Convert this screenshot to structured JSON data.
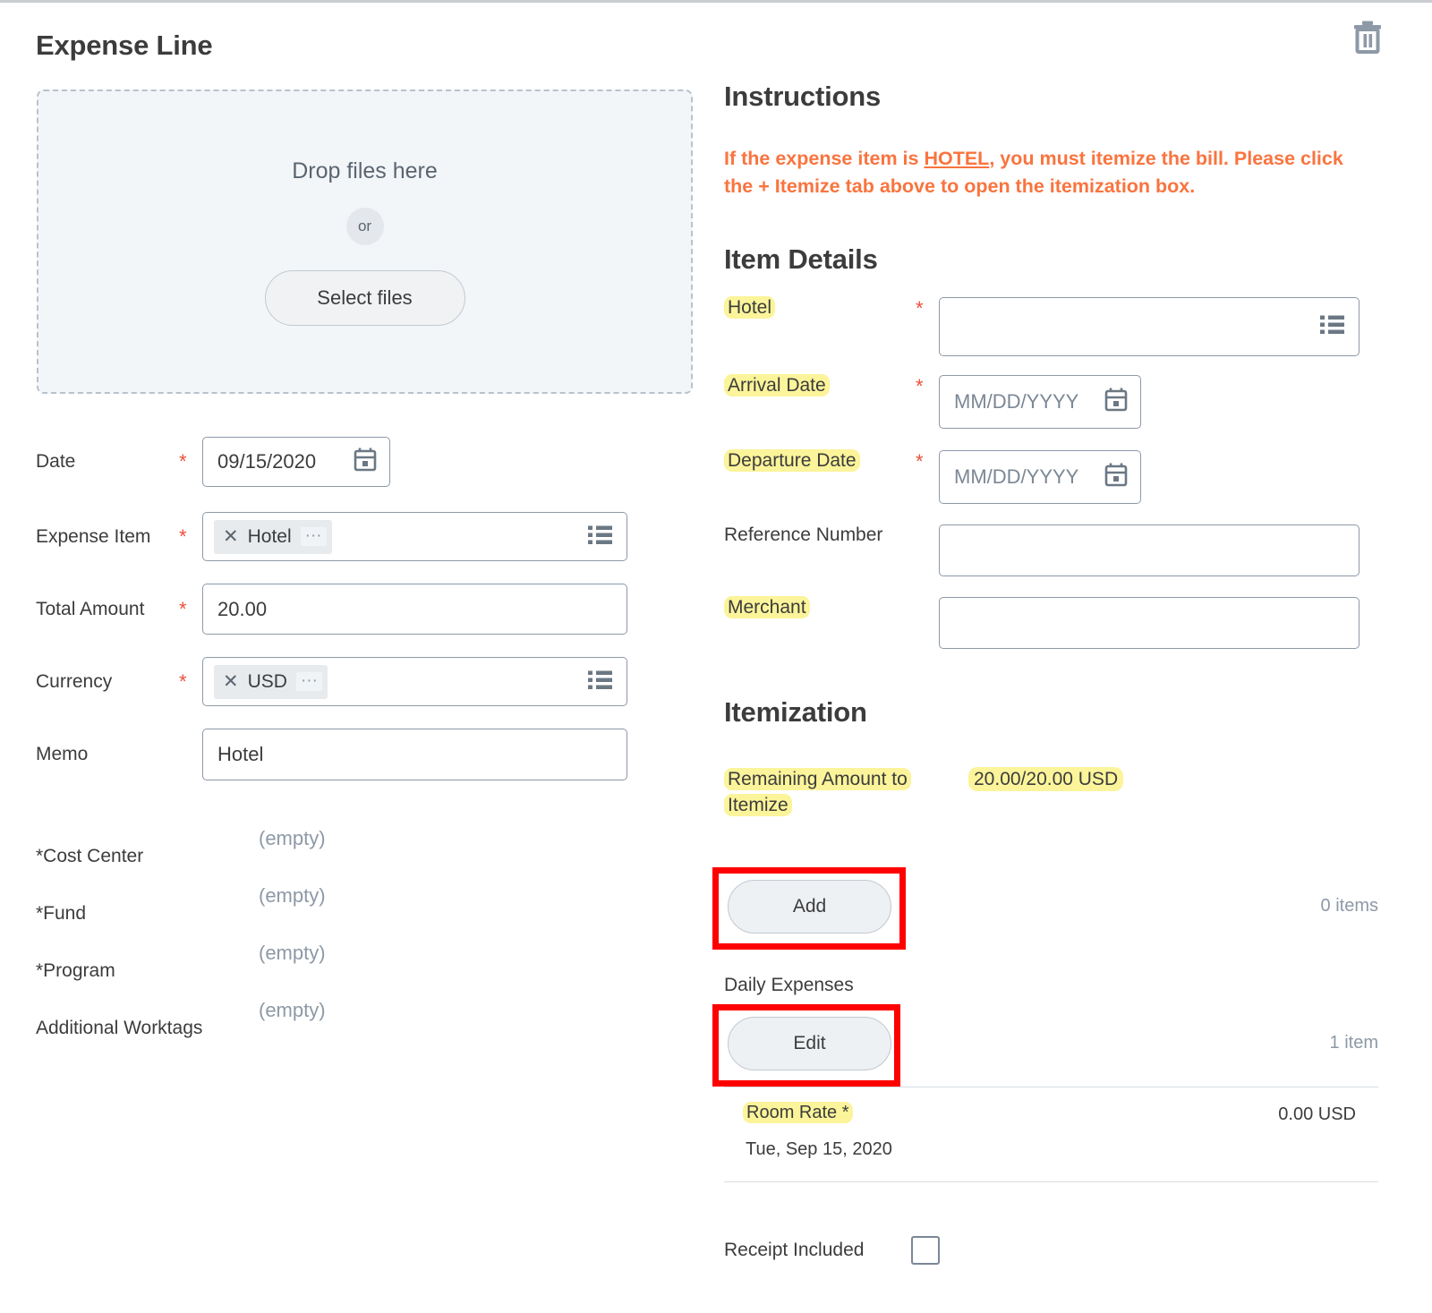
{
  "page": {
    "title": "Expense Line",
    "delete_icon": "trash-icon"
  },
  "attachments": {
    "drop_text": "Drop files here",
    "or_text": "or",
    "select_files_label": "Select files"
  },
  "left_form": {
    "rows": [
      {
        "label": "Date",
        "required": "*",
        "value": "09/15/2020",
        "type": "date"
      },
      {
        "label": "Expense Item",
        "required": "*",
        "value": "Hotel",
        "type": "pill"
      },
      {
        "label": "Total Amount",
        "required": "*",
        "value": "20.00",
        "type": "text"
      },
      {
        "label": "Currency",
        "required": "*",
        "value": "USD",
        "type": "pill"
      },
      {
        "label": "Memo",
        "required": "",
        "value": "Hotel",
        "type": "text"
      }
    ],
    "worktags": [
      {
        "label": "*Cost Center",
        "value": "(empty)"
      },
      {
        "label": "*Fund",
        "value": "(empty)"
      },
      {
        "label": "*Program",
        "value": "(empty)"
      },
      {
        "label": "Additional Worktags",
        "value": "(empty)"
      }
    ]
  },
  "instructions": {
    "heading": "Instructions",
    "body_part1": "If the expense item is ",
    "body_hotel": "HOTEL",
    "body_part2": ", you must itemize the bill. Please click the + Itemize tab above to open the itemization box."
  },
  "item_details": {
    "heading": "Item Details",
    "rows": [
      {
        "label": "Hotel",
        "required": "*",
        "placeholder": "",
        "highlight": true
      },
      {
        "label": "Arrival Date",
        "required": "*",
        "placeholder": "MM/DD/YYYY",
        "highlight": true
      },
      {
        "label": "Departure Date",
        "required": "*",
        "placeholder": "MM/DD/YYYY",
        "highlight": true
      },
      {
        "label": "Reference Number",
        "required": "",
        "placeholder": "",
        "highlight": false
      },
      {
        "label": "Merchant",
        "required": "",
        "placeholder": "",
        "highlight": true
      }
    ]
  },
  "itemization": {
    "heading": "Itemization",
    "remaining_label": "Remaining Amount to Itemize",
    "remaining_value": "20.00/20.00 USD",
    "add_label": "Add",
    "add_count": "0 items",
    "daily_expenses_label": "Daily Expenses",
    "edit_label": "Edit",
    "edit_count": "1 item",
    "line_item": {
      "name": "Room Rate *",
      "amount": "0.00 USD",
      "date": "Tue, Sep 15, 2020"
    }
  },
  "receipt": {
    "label": "Receipt Included",
    "checked": false
  },
  "colors": {
    "highlight": "#fbf49a",
    "annotation": "#fe0000",
    "instruction": "#f9743f",
    "required": "#ef4e3b"
  }
}
